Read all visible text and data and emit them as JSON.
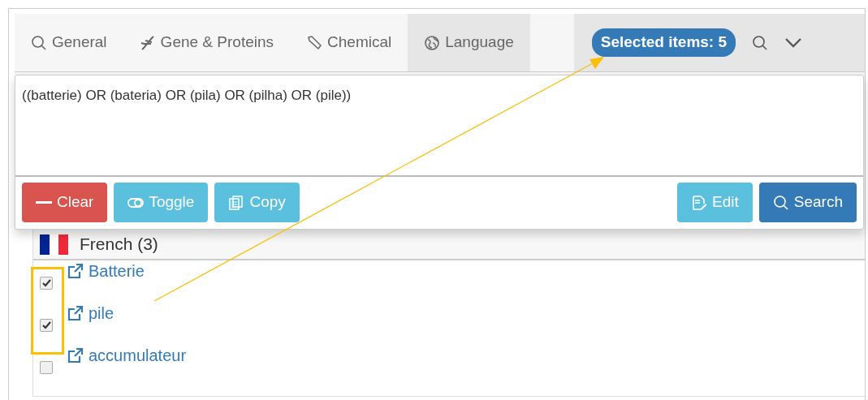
{
  "tabs": [
    {
      "label": "General",
      "kind": "search",
      "selected": false
    },
    {
      "label": "Gene & Proteins",
      "kind": "dna",
      "selected": false
    },
    {
      "label": "Chemical",
      "kind": "pipette",
      "selected": false
    },
    {
      "label": "Language",
      "kind": "globe",
      "selected": true
    }
  ],
  "selected_badge": "Selected items: 5",
  "query": "((batterie) OR (bateria) OR (pila) OR (pilha) OR (pile))",
  "buttons_left": [
    {
      "label": "Clear",
      "kind": "minus"
    },
    {
      "label": "Toggle",
      "kind": "toggle"
    },
    {
      "label": "Copy",
      "kind": "copy"
    }
  ],
  "buttons_right": [
    {
      "label": "Edit",
      "kind": "edit"
    },
    {
      "label": "Search",
      "kind": "search"
    }
  ],
  "group": {
    "name": "French (3)",
    "items": [
      {
        "label": "Batterie",
        "checked": true
      },
      {
        "label": "pile",
        "checked": true
      },
      {
        "label": "accumulateur",
        "checked": false
      }
    ]
  }
}
